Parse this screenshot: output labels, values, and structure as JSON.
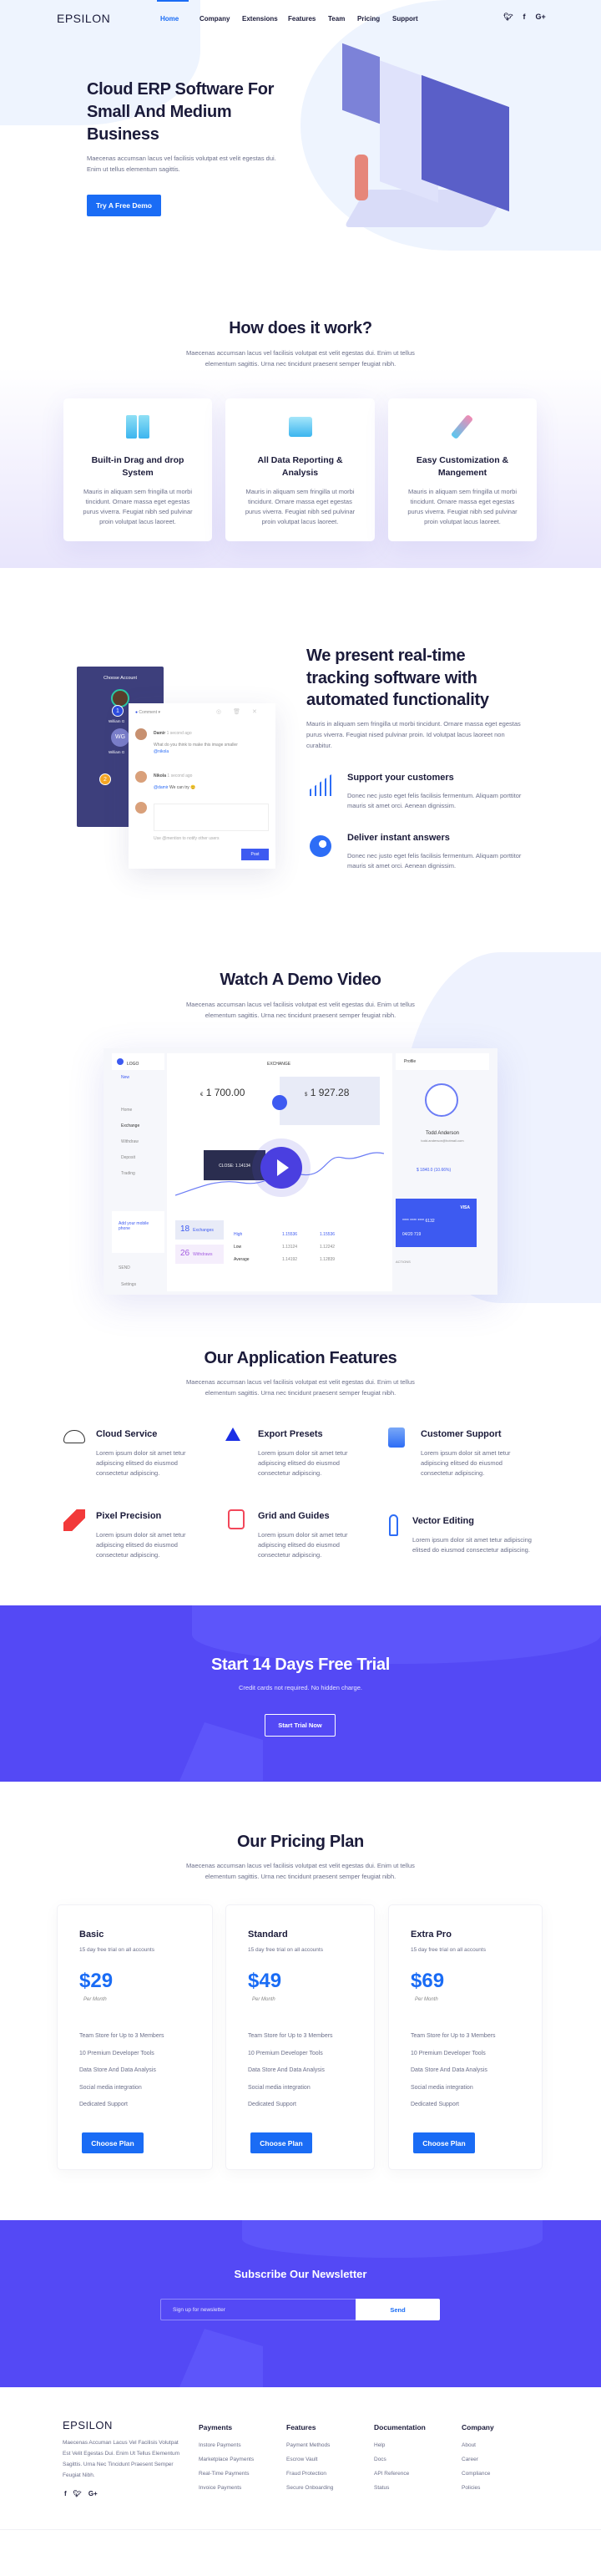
{
  "brand": {
    "logo": "EPSILON",
    "accent": "#1a6cf5",
    "band": "#5449f5",
    "heading": "#1b1b3a"
  },
  "nav": {
    "items": [
      "Home",
      "Company",
      "Extensions",
      "Features",
      "Team",
      "Pricing",
      "Support"
    ],
    "active": "Home",
    "social": [
      "twitter-icon",
      "facebook-icon",
      "google-plus-icon"
    ]
  },
  "hero": {
    "title": "Cloud ERP Software For Small And Medium Business",
    "text": "Maecenas accumsan lacus vel facilisis volutpat est velit egestas dui. Enim ut tellus elementum sagittis.",
    "cta": "Try A Free Demo"
  },
  "how": {
    "title": "How does it work?",
    "text": "Maecenas accumsan lacus vel facilisis volutpat est velit egestas dui. Enim ut tellus elementum sagittis. Urna nec tincidunt praesent semper feugiat nibh.",
    "cards": [
      {
        "title": "Built-in Drag and drop System",
        "text": "Mauris in aliquam sem fringilla ut morbi tincidunt. Ornare massa eget egestas purus viverra. Feugiat nibh sed pulvinar proin volutpat lacus laoreet.",
        "icon": "server-icon"
      },
      {
        "title": "All Data Reporting & Analysis",
        "text": "Mauris in aliquam sem fringilla ut morbi tincidunt. Ornare massa eget egestas purus viverra. Feugiat nibh sed pulvinar proin volutpat lacus laoreet.",
        "icon": "folder-icon"
      },
      {
        "title": "Easy Customization & Mangement",
        "text": "Mauris in aliquam sem fringilla ut morbi tincidunt. Ornare massa eget egestas purus viverra. Feugiat nibh sed pulvinar proin volutpat lacus laoreet.",
        "icon": "pen-icon"
      }
    ]
  },
  "tracking": {
    "title": "We present real-time tracking software with automated functionality",
    "text": "Mauris in aliquam sem fringilla ut morbi tincidunt. Ornare massa eget egestas purus viverra. Feugiat nised pulvinar proin. Id volutpat lacus laoreet non curabitur.",
    "items": [
      {
        "title": "Support your customers",
        "text": "Donec nec justo eget felis facilisis fermentum. Aliquam porttitor mauris sit amet orci. Aenean dignissim.",
        "icon": "chart-growth-icon"
      },
      {
        "title": "Deliver instant answers",
        "text": "Donec nec justo eget felis facilisis fermentum. Aliquam porttitor mauris sit amet orci. Aenean dignissim.",
        "icon": "globe-icon"
      }
    ],
    "mock": {
      "choose": "Choose Account",
      "user1": "William G",
      "initials": "WG",
      "user2": "William G",
      "badge1": "1",
      "badge2": "2",
      "comment": "Comment",
      "c1_name": "Damir",
      "c1_time": "1 second ago",
      "c1_text": "What do you think to make this image smaller",
      "c1_mention": "@nikola",
      "c2_name": "Nikola",
      "c2_time": "1 second ago",
      "c2_mention": "@damir",
      "c2_text": "We can try 😊",
      "hint": "Use @mention to notify other users",
      "post": "Post"
    }
  },
  "demo": {
    "title": "Watch A Demo Video",
    "text": "Maecenas accumsan lacus vel facilisis volutpat est velit egestas dui. Enim ut tellus elementum sagittis. Urna nec tincidunt praesent semper feugiat nibh.",
    "dash": {
      "logo": "LOGO",
      "new": "New",
      "menu": [
        "Home",
        "Exchange",
        "Withdraw",
        "Deposit",
        "Trading"
      ],
      "phone": "Add your mobile phone",
      "send": "SEND",
      "settings": "Settings",
      "header": "EXCHANGE",
      "eur": "€",
      "amount1": "1 700.00",
      "usd": "$",
      "amount2": "1 927.28",
      "tooltip": "CLOSE: 1.14134",
      "stat1": "18",
      "stat1_label": "Exchanges",
      "stat2": "26",
      "stat2_label": "Withdraws",
      "rows": [
        [
          "High",
          "1.15536",
          "1.15536"
        ],
        [
          "Low",
          "1.13124",
          "1.12242"
        ],
        [
          "Average",
          "1.14192",
          "1.12839"
        ]
      ],
      "profile": "Profile",
      "name": "Todd Anderson",
      "email": "todd.anderson@hotmail.com",
      "volume": "$ 1840.0 (10.66%)",
      "card_brand": "VISA",
      "card_number": "**** **** **** 6132",
      "card_exp": "04/20  719",
      "actions": "ACTIONS"
    }
  },
  "features": {
    "title": "Our Application Features",
    "text": "Maecenas accumsan lacus vel facilisis volutpat est velit egestas dui. Enim ut tellus elementum sagittis. Urna nec tincidunt praesent semper feugiat nibh.",
    "items": [
      {
        "title": "Cloud Service",
        "text": "Lorem ipsum dolor sit amet tetur adipiscing elitsed do eiusmod consectetur adipiscing.",
        "icon": "cloud-check-icon"
      },
      {
        "title": "Export Presets",
        "text": "Lorem ipsum dolor sit amet tetur adipiscing elitsed do eiusmod consectetur adipiscing.",
        "icon": "triangle-icon"
      },
      {
        "title": "Customer Support",
        "text": "Lorem ipsum dolor sit amet tetur adipiscing elitsed do eiusmod consectetur adipiscing.",
        "icon": "thumbs-up-tools-icon"
      },
      {
        "title": "Pixel Precision",
        "text": "Lorem ipsum dolor sit amet tetur adipiscing elitsed do eiusmod consectetur adipiscing.",
        "icon": "pixels-icon"
      },
      {
        "title": "Grid and Guides",
        "text": "Lorem ipsum dolor sit amet tetur adipiscing elitsed do eiusmod consectetur adipiscing.",
        "icon": "cards-icon"
      },
      {
        "title": "Vector Editing",
        "text": "Lorem ipsum dolor sit amet tetur adipiscing elitsed do eiusmod consectetur adipiscing.",
        "icon": "pen-nib-icon"
      }
    ]
  },
  "trial": {
    "title": "Start 14 Days Free Trial",
    "text": "Credit cards not required. No hidden charge.",
    "cta": "Start Trial Now"
  },
  "pricing": {
    "title": "Our Pricing Plan",
    "text": "Maecenas accumsan lacus vel facilisis volutpat est velit egestas dui. Enim ut tellus elementum sagittis. Urna nec tincidunt praesent semper feugiat nibh.",
    "plans": [
      {
        "name": "Basic",
        "sub": "15 day free trial on all accounts",
        "price": "$29",
        "per": "Per Month",
        "cta": "Choose Plan"
      },
      {
        "name": "Standard",
        "sub": "15 day free trial on all accounts",
        "price": "$49",
        "per": "Per Month",
        "cta": "Choose Plan"
      },
      {
        "name": "Extra Pro",
        "sub": "15 day free trial on all accounts",
        "price": "$69",
        "per": "Per Month",
        "cta": "Choose Plan"
      }
    ],
    "features": [
      "Team Store for Up to 3 Members",
      "10 Premium Developer Tools",
      "Data Store And Data Analysis",
      "Social media integration",
      "Dedicated Support"
    ]
  },
  "newsletter": {
    "title": "Subscribe Our Newsletter",
    "placeholder": "Sign up for newsletter",
    "cta": "Send"
  },
  "footer": {
    "logo": "EPSILON",
    "text": "Maecenas Accuman Lacus Vel Facilisis Volutpat Est Velit Egestas Dui. Enim Ut Tellus Elementum Sagittis. Urna Nec Tincidunt Praesent Semper Feugiat Nibh.",
    "cols": [
      {
        "title": "Payments",
        "links": [
          "Instore Payments",
          "Marketplace Payments",
          "Real-Time Payments",
          "Invoice Payments"
        ]
      },
      {
        "title": "Features",
        "links": [
          "Payment Methods",
          "Escrow Vault",
          "Fraud Protection",
          "Secure Onboarding"
        ]
      },
      {
        "title": "Documentation",
        "links": [
          "Help",
          "Docs",
          "API Reference",
          "Status"
        ]
      },
      {
        "title": "Company",
        "links": [
          "About",
          "Career",
          "Compliance",
          "Policies"
        ]
      }
    ]
  }
}
